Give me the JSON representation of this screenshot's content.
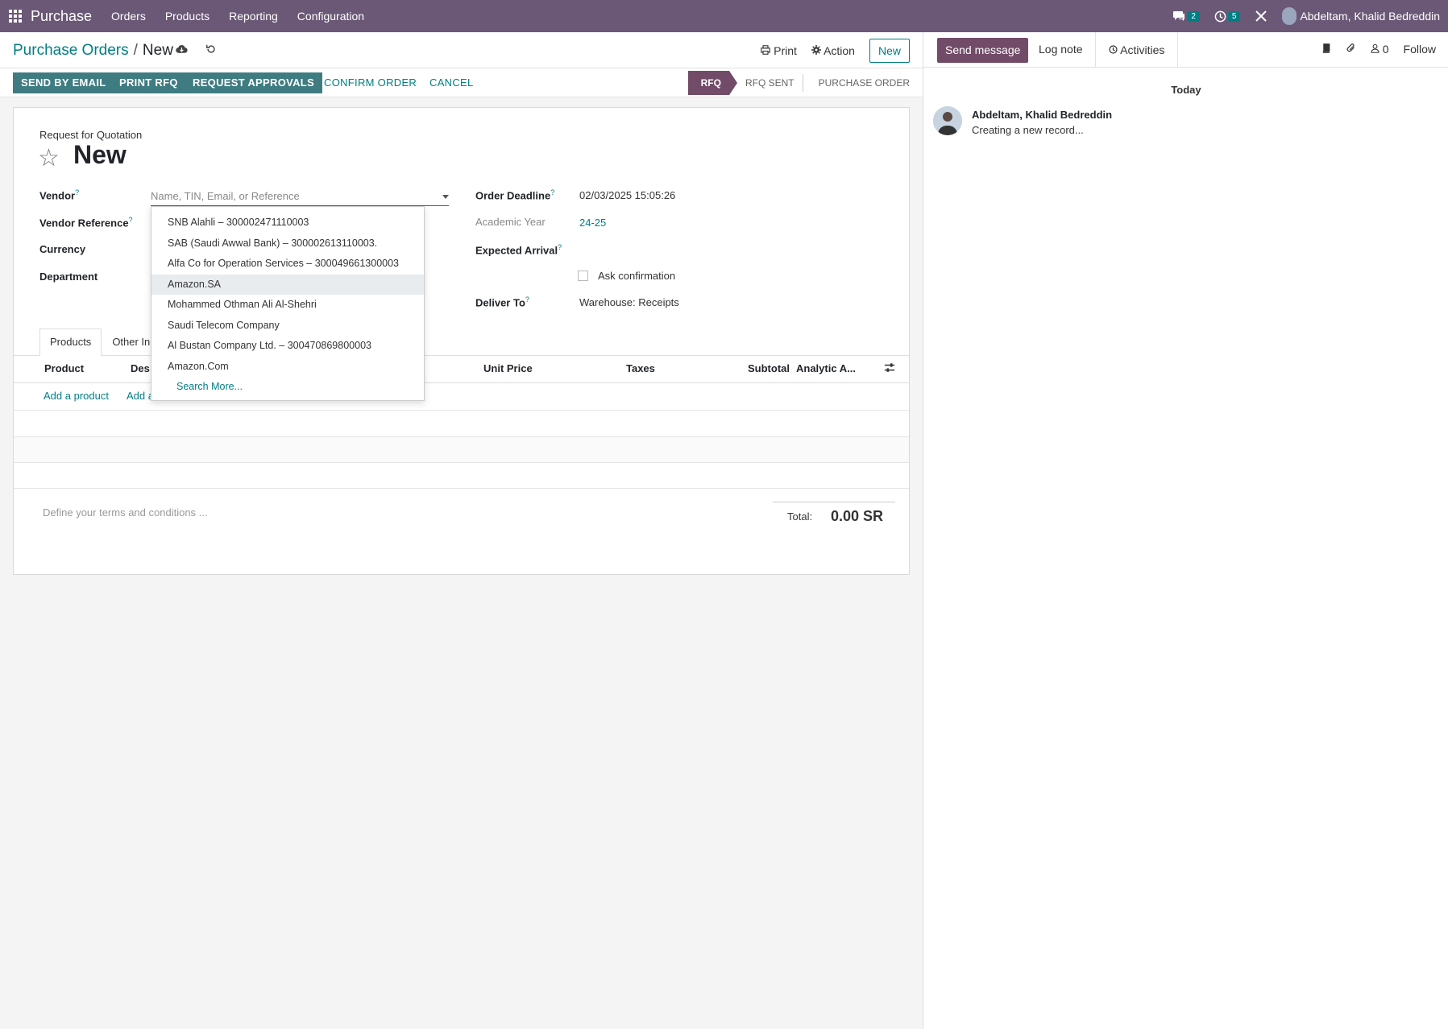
{
  "navbar": {
    "app_name": "Purchase",
    "menu": [
      "Orders",
      "Products",
      "Reporting",
      "Configuration"
    ],
    "messages_count": "2",
    "activities_count": "5",
    "user_name": "Abdeltam, Khalid Bedreddin"
  },
  "control": {
    "breadcrumb_parent": "Purchase Orders",
    "breadcrumb_current": "New",
    "print_label": "Print",
    "action_label": "Action",
    "new_label": "New"
  },
  "statusbar": {
    "buttons": [
      "SEND BY EMAIL",
      "PRINT RFQ",
      "REQUEST APPROVALS",
      "CONFIRM ORDER",
      "CANCEL"
    ],
    "stages": [
      "RFQ",
      "RFQ SENT",
      "PURCHASE ORDER"
    ],
    "active_stage": "RFQ"
  },
  "form": {
    "doc_type": "Request for Quotation",
    "doc_name": "New",
    "vendor_label": "Vendor",
    "vendor_placeholder": "Name, TIN, Email, or Reference",
    "vendor_reference_label": "Vendor Reference",
    "currency_label": "Currency",
    "department_label": "Department",
    "order_deadline_label": "Order Deadline",
    "order_deadline_value": "02/03/2025 15:05:26",
    "academic_year_label": "Academic Year",
    "academic_year_value": "24-25",
    "expected_arrival_label": "Expected Arrival",
    "ask_confirmation_label": "Ask confirmation",
    "deliver_to_label": "Deliver To",
    "deliver_to_value": "Warehouse: Receipts",
    "tabs": [
      "Products",
      "Other In"
    ],
    "columns": [
      "Product",
      "Des",
      "Unit Price",
      "Taxes",
      "Subtotal",
      "Analytic A..."
    ],
    "add_product": "Add a product",
    "add_section": "Add a",
    "terms_placeholder": "Define your terms and conditions ...",
    "total_label": "Total:",
    "total_value": "0.00 SR"
  },
  "vendor_dropdown": {
    "options": [
      "SNB Alahli – 300002471110003",
      "SAB (Saudi Awwal Bank) – 300002613110003.",
      "Alfa Co for Operation Services – 300049661300003",
      "Amazon.SA",
      "Mohammed Othman Ali Al-Shehri",
      "Saudi Telecom Company",
      "Al Bustan Company Ltd. – 300470869800003",
      "Amazon.Com"
    ],
    "highlighted_index": 3,
    "search_more": "Search More..."
  },
  "chatter": {
    "send_message": "Send message",
    "log_note": "Log note",
    "activities": "Activities",
    "followers_count": "0",
    "follow": "Follow",
    "date_separator": "Today",
    "message": {
      "author": "Abdeltam, Khalid Bedreddin",
      "body": "Creating a new record..."
    }
  },
  "colors": {
    "navbar": "#6b5876",
    "primary": "#714b67",
    "accent": "#017e84"
  }
}
